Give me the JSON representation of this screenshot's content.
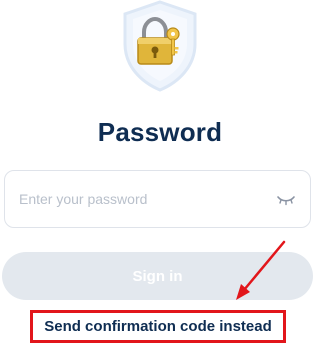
{
  "icons": {
    "shield": "shield-icon",
    "lock": "padlock-icon",
    "key": "key-icon",
    "eye": "eye-closed-icon"
  },
  "header": {
    "title": "Password"
  },
  "form": {
    "password_placeholder": "Enter your password",
    "password_value": "",
    "signin_label": "Sign in",
    "signin_disabled": true
  },
  "links": {
    "confirmation_code": "Send confirmation code instead"
  },
  "colors": {
    "title": "#0f2d52",
    "button_bg": "#e3e8ee",
    "annotation_red": "#e2161b",
    "shield_fill": "#e8f0fb",
    "lock_gold": "#e0b53a"
  }
}
